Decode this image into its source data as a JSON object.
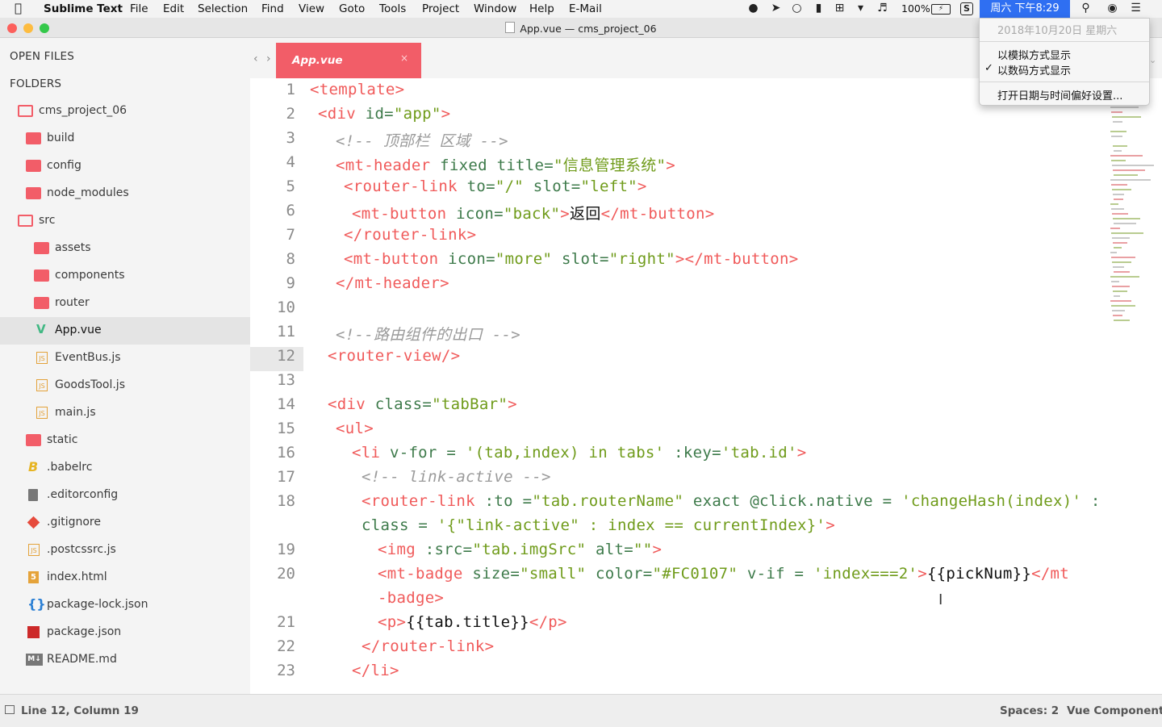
{
  "menubar": {
    "app_name": "Sublime Text",
    "items": [
      "File",
      "Edit",
      "Selection",
      "Find",
      "View",
      "Goto",
      "Tools",
      "Project",
      "Window",
      "Help",
      "E-Mail"
    ],
    "battery": "100%",
    "clock": "周六 下午8:29"
  },
  "window": {
    "title": "App.vue — cms_project_06"
  },
  "sidebar": {
    "open_files_header": "OPEN FILES",
    "folders_header": "FOLDERS",
    "items": [
      {
        "label": "cms_project_06",
        "icon": "folder-open-icon"
      },
      {
        "label": "build",
        "icon": "folder-icon"
      },
      {
        "label": "config",
        "icon": "folder-icon"
      },
      {
        "label": "node_modules",
        "icon": "folder-icon"
      },
      {
        "label": "src",
        "icon": "folder-open-icon"
      },
      {
        "label": "assets",
        "icon": "folder-icon"
      },
      {
        "label": "components",
        "icon": "folder-icon"
      },
      {
        "label": "router",
        "icon": "folder-icon"
      },
      {
        "label": "App.vue",
        "icon": "vue-icon"
      },
      {
        "label": "EventBus.js",
        "icon": "js-icon"
      },
      {
        "label": "GoodsTool.js",
        "icon": "js-icon"
      },
      {
        "label": "main.js",
        "icon": "js-icon"
      },
      {
        "label": "static",
        "icon": "folder-icon"
      },
      {
        "label": ".babelrc",
        "icon": "babel-icon"
      },
      {
        "label": ".editorconfig",
        "icon": "file-icon"
      },
      {
        "label": ".gitignore",
        "icon": "git-icon"
      },
      {
        "label": ".postcssrc.js",
        "icon": "js-icon"
      },
      {
        "label": "index.html",
        "icon": "html5-icon"
      },
      {
        "label": "package-lock.json",
        "icon": "json-icon"
      },
      {
        "label": "package.json",
        "icon": "npm-icon"
      },
      {
        "label": "README.md",
        "icon": "markdown-icon"
      }
    ]
  },
  "editor": {
    "tab_label": "App.vue",
    "tab_close": "×",
    "line_numbers": [
      "1",
      "2",
      "3",
      "4",
      "5",
      "6",
      "7",
      "8",
      "9",
      "10",
      "11",
      "12",
      "13",
      "14",
      "15",
      "16",
      "17",
      "18",
      "",
      "19",
      "20",
      "",
      "21",
      "22",
      "23"
    ],
    "lines": [
      [
        [
          "t",
          "<template>"
        ]
      ],
      [
        [
          "t",
          "<div "
        ],
        [
          "a",
          "id="
        ],
        [
          "s",
          "\"app\""
        ],
        [
          "t",
          ">"
        ]
      ],
      [
        [
          "c",
          "<!-- 顶部栏 区域 -->"
        ]
      ],
      [
        [
          "t",
          "<mt-header "
        ],
        [
          "a",
          "fixed title="
        ],
        [
          "s",
          "\"信息管理系统\""
        ],
        [
          "t",
          ">"
        ]
      ],
      [
        [
          "t",
          "<router-link "
        ],
        [
          "a",
          "to="
        ],
        [
          "s",
          "\"/\""
        ],
        [
          "a",
          " slot="
        ],
        [
          "s",
          "\"left\""
        ],
        [
          "t",
          ">"
        ]
      ],
      [
        [
          "t",
          "<mt-button "
        ],
        [
          "a",
          "icon="
        ],
        [
          "s",
          "\"back\""
        ],
        [
          "t",
          ">"
        ],
        [
          "x",
          "返回"
        ],
        [
          "t",
          "</mt-button>"
        ]
      ],
      [
        [
          "t",
          "</router-link>"
        ]
      ],
      [
        [
          "t",
          "<mt-button "
        ],
        [
          "a",
          "icon="
        ],
        [
          "s",
          "\"more\""
        ],
        [
          "a",
          " slot="
        ],
        [
          "s",
          "\"right\""
        ],
        [
          "t",
          "></mt-button>"
        ]
      ],
      [
        [
          "t",
          "</mt-header>"
        ]
      ],
      [],
      [
        [
          "c",
          "<!--路由组件的出口 -->"
        ]
      ],
      [
        [
          "t",
          "<router-view/>"
        ]
      ],
      [],
      [
        [
          "t",
          "<div "
        ],
        [
          "a",
          "class="
        ],
        [
          "s",
          "\"tabBar\""
        ],
        [
          "t",
          ">"
        ]
      ],
      [
        [
          "t",
          "<ul>"
        ]
      ],
      [
        [
          "t",
          "<li "
        ],
        [
          "a",
          "v-for = "
        ],
        [
          "s",
          "'(tab,index) in tabs'"
        ],
        [
          "a",
          " :key="
        ],
        [
          "s",
          "'tab.id'"
        ],
        [
          "t",
          ">"
        ]
      ],
      [
        [
          "c",
          "<!-- link-active -->"
        ]
      ],
      [
        [
          "t",
          "<router-link "
        ],
        [
          "a",
          ":to ="
        ],
        [
          "s",
          "\"tab.routerName\""
        ],
        [
          "a",
          " exact @click.native = "
        ],
        [
          "s",
          "'changeHash(index)'"
        ],
        [
          "a",
          " :"
        ]
      ],
      [
        [
          "a",
          "class = "
        ],
        [
          "s",
          "'{\"link-active\" : index == currentIndex}'"
        ],
        [
          "t",
          ">"
        ]
      ],
      [
        [
          "t",
          "<img "
        ],
        [
          "a",
          ":src="
        ],
        [
          "s",
          "\"tab.imgSrc\""
        ],
        [
          "a",
          " alt="
        ],
        [
          "s",
          "\"\""
        ],
        [
          "t",
          ">"
        ]
      ],
      [
        [
          "t",
          "<mt-badge "
        ],
        [
          "a",
          "size="
        ],
        [
          "s",
          "\"small\""
        ],
        [
          "a",
          " color="
        ],
        [
          "s",
          "\"#FC0107\""
        ],
        [
          "a",
          " v-if = "
        ],
        [
          "s",
          "'index===2'"
        ],
        [
          "t",
          ">"
        ],
        [
          "x",
          "{{pickNum}}"
        ],
        [
          "t",
          "</mt"
        ]
      ],
      [
        [
          "t",
          "-badge>"
        ]
      ],
      [
        [
          "t",
          "<p>"
        ],
        [
          "x",
          "{{tab.title}}"
        ],
        [
          "t",
          "</p>"
        ]
      ],
      [
        [
          "t",
          "</router-link>"
        ]
      ],
      [
        [
          "t",
          "</li>"
        ]
      ]
    ],
    "indents": [
      0,
      1,
      3,
      3,
      4,
      5,
      4,
      4,
      3,
      0,
      3,
      2,
      0,
      2,
      3,
      5,
      6,
      6,
      6,
      8,
      8,
      8,
      8,
      6,
      5
    ]
  },
  "status": {
    "position": "Line 12, Column 19",
    "spaces": "Spaces: 2",
    "syntax": "Vue Component"
  },
  "clock_menu": {
    "date": "2018年10月20日 星期六",
    "analog": "以模拟方式显示",
    "digital": "以数码方式显示",
    "checkmark": "✓",
    "prefs": "打开日期与时间偏好设置..."
  },
  "colors": {
    "accent": "#f25d68",
    "tag": "#f05a5a",
    "string": "#6f9b1a",
    "attribute": "#3d7a4a",
    "comment": "#9a9a9a",
    "clock_highlight": "#2f6ff2"
  }
}
